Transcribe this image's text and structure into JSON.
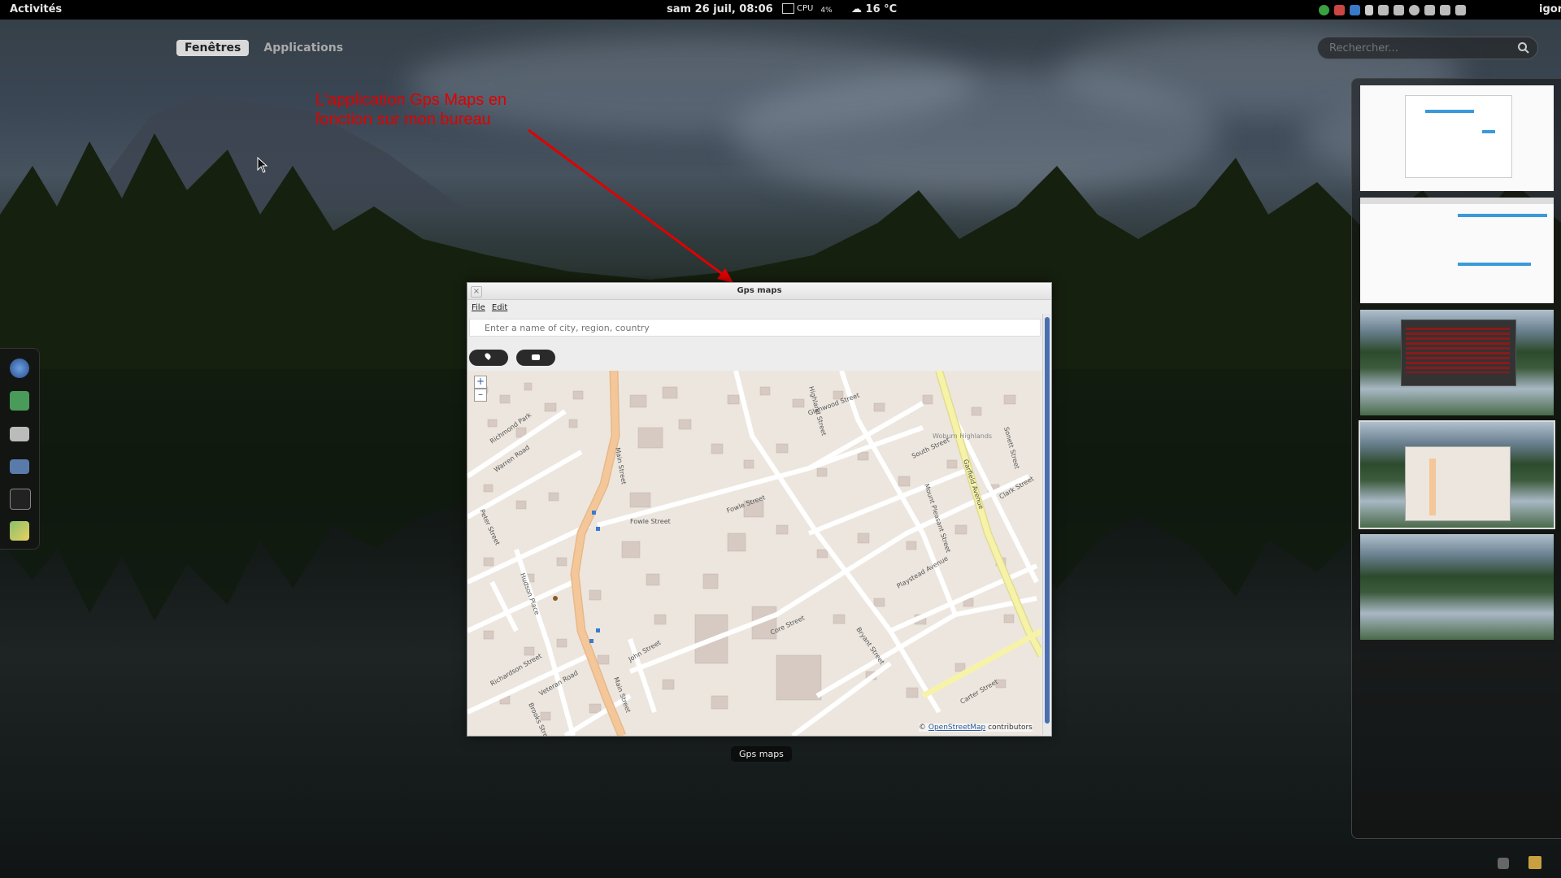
{
  "topbar": {
    "activities": "Activités",
    "clock": "sam 26 juil, 08:06",
    "cpu_label": "CPU",
    "cpu_value": "4%",
    "weather": "16 °C",
    "user": "igor"
  },
  "overview": {
    "tabs": [
      {
        "label": "Fenêtres",
        "active": true
      },
      {
        "label": "Applications",
        "active": false
      }
    ],
    "search_placeholder": "Rechercher..."
  },
  "annotation": {
    "text": "L'application Gps Maps en fonction sur mon bureau",
    "color": "#e00000"
  },
  "dash": {
    "apps": [
      "browser-icon",
      "maps-icon",
      "files-icon",
      "display-icon",
      "terminal-icon",
      "gps-maps-icon"
    ]
  },
  "gps_window": {
    "title": "Gps maps",
    "menu": [
      "File",
      "Edit"
    ],
    "search_placeholder": "Enter a name of city, region, country",
    "zoom_in": "+",
    "zoom_out": "–",
    "attribution_prefix": "©",
    "attribution_link": "OpenStreetMap",
    "attribution_suffix": "contributors",
    "caption": "Gps maps",
    "streets": [
      "Main Street",
      "Fowle Street",
      "Glenwood Street",
      "Highland Street",
      "Richmond Park",
      "Warren Road",
      "Peter Street",
      "South Street",
      "Garfield Avenue",
      "Clark Street",
      "Mount Pleasant Street",
      "Playstead Avenue",
      "Core Street",
      "Bryant Street",
      "Carter Street",
      "Woburn Highlands",
      "Hudson Place",
      "Richardson Street",
      "Veteran Road",
      "Brooks Street",
      "Sonett Street",
      "John Street"
    ]
  },
  "workspaces": {
    "count": 5,
    "active_index": 3
  },
  "colors": {
    "accent": "#4a6fb0",
    "main_road": "#f4c79a",
    "secondary_road": "#f6f3a8"
  }
}
